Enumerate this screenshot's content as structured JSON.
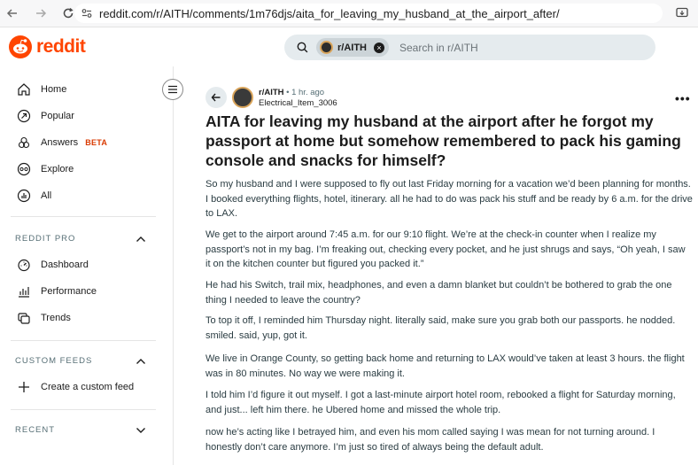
{
  "browser": {
    "url": "reddit.com/r/AITH/comments/1m76djs/aita_for_leaving_my_husband_at_the_airport_after/"
  },
  "header": {
    "logo_text": "reddit",
    "search": {
      "chip_label": "r/AITH",
      "placeholder": "Search in r/AITH"
    }
  },
  "sidebar": {
    "items": [
      {
        "label": "Home",
        "icon": "home-icon"
      },
      {
        "label": "Popular",
        "icon": "popular-icon"
      },
      {
        "label": "Answers",
        "icon": "answers-icon",
        "badge": "BETA"
      },
      {
        "label": "Explore",
        "icon": "explore-icon"
      },
      {
        "label": "All",
        "icon": "all-icon"
      }
    ],
    "sections": {
      "pro": {
        "title": "REDDIT PRO",
        "items": [
          {
            "label": "Dashboard",
            "icon": "dashboard-icon"
          },
          {
            "label": "Performance",
            "icon": "performance-icon"
          },
          {
            "label": "Trends",
            "icon": "trends-icon"
          }
        ]
      },
      "custom_feeds": {
        "title": "CUSTOM FEEDS",
        "items": [
          {
            "label": "Create a custom feed",
            "icon": "plus-icon"
          }
        ]
      },
      "recent": {
        "title": "RECENT"
      }
    }
  },
  "post": {
    "subreddit": "r/AITH",
    "time": "• 1 hr. ago",
    "author": "Electrical_Item_3006",
    "title": "AITA for leaving my husband at the airport after he forgot my passport at home but somehow remembered to pack his gaming console and snacks for himself?",
    "paragraphs": [
      "So my husband and I were supposed to fly out last Friday morning for a vacation we’d been planning for months. I booked everything flights, hotel, itinerary. all he had to do was pack his stuff and be ready by 6 a.m. for the drive to LAX.",
      "We get to the airport around 7:45 a.m. for our 9:10 flight. We’re at the check-in counter when I realize my passport’s not in my bag. I’m freaking out, checking every pocket, and he just shrugs and says, “Oh yeah, I saw it on the kitchen counter but figured you packed it.”",
      "He had his Switch, trail mix, headphones, and even a damn blanket but couldn’t be bothered to grab the one thing I needed to leave the country?",
      "To top it off, I reminded him Thursday night. literally said, make sure you grab both our passports. he nodded. smiled. said, yup, got it.",
      "We live in Orange County, so getting back home and returning to LAX would’ve taken at least 3 hours. the flight was in 80 minutes. No way we were making it.",
      "I told him I’d figure it out myself. I got a last-minute airport hotel room, rebooked a flight for Saturday morning, and just... left him there. he Ubered home and missed the whole trip.",
      "now he’s acting like I betrayed him, and even his mom called saying I was mean for not turning around. I honestly don’t care anymore. I’m just so tired of always being the default adult."
    ]
  },
  "colors": {
    "brand": "#ff4500",
    "beta": "#d93a00",
    "search_bg": "#e5ebee"
  }
}
